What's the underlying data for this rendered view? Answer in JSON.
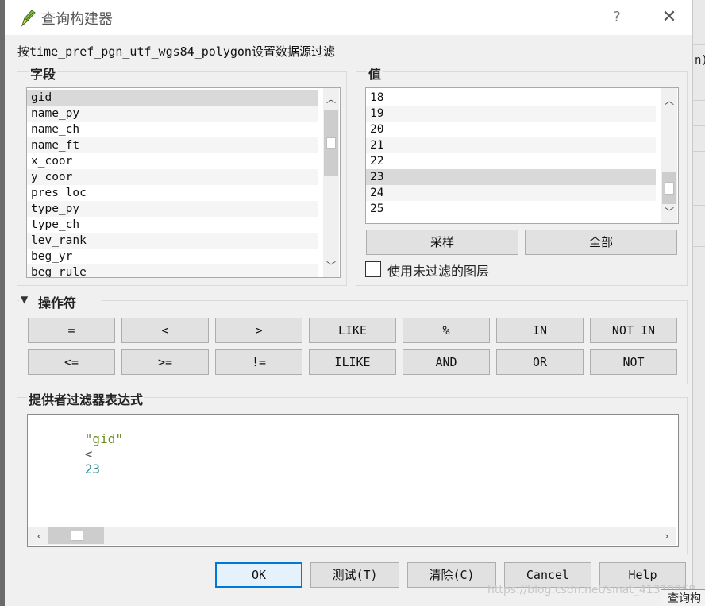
{
  "window": {
    "title": "查询构建器",
    "help_label": "?",
    "close_label": "✕",
    "icon": "qgis-pencil-icon"
  },
  "subtitle": "按time_pref_pgn_utf_wgs84_polygon设置数据源过滤",
  "fields": {
    "title": "字段",
    "items": [
      "gid",
      "name_py",
      "name_ch",
      "name_ft",
      "x_coor",
      "y_coor",
      "pres_loc",
      "type_py",
      "type_ch",
      "lev_rank",
      "beg_yr",
      "beg_rule"
    ],
    "selected": "gid"
  },
  "values": {
    "title": "值",
    "items": [
      "18",
      "19",
      "20",
      "21",
      "22",
      "23",
      "24",
      "25"
    ],
    "selected": "23",
    "sample_label": "采样",
    "all_label": "全部",
    "use_unfiltered_label": "使用未过滤的图层",
    "use_unfiltered_checked": false
  },
  "operators": {
    "title": "操作符",
    "expanded": true,
    "row1": [
      "=",
      "<",
      ">",
      "LIKE",
      "%",
      "IN",
      "NOT IN"
    ],
    "row2": [
      "<=",
      ">=",
      "!=",
      "ILIKE",
      "AND",
      "OR",
      "NOT"
    ]
  },
  "expression": {
    "title": "提供者过滤器表达式",
    "field_token": "\"gid\"",
    "operator_token": "<",
    "value_token": "23",
    "colors": {
      "field": "#6b8e23",
      "operator": "#555555",
      "value": "#2e8b8b"
    }
  },
  "buttons": {
    "ok": "OK",
    "test": "测试(T)",
    "clear": "清除(C)",
    "cancel": "Cancel",
    "help": "Help"
  },
  "background": {
    "right_fragment": "n)",
    "bottom_right_fragment": "查询构",
    "watermark": "https://blog.csdn.net/sinat_41310868"
  },
  "colors": {
    "accent": "#0078d7",
    "selection": "#d9d9d9"
  }
}
